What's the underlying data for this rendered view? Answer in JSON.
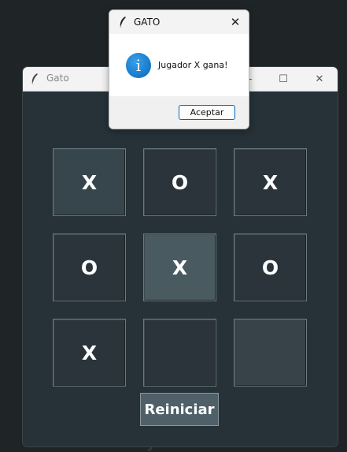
{
  "main_window": {
    "title": "Gato",
    "controls": {
      "minimize": "—",
      "maximize": "☐",
      "close": "✕"
    }
  },
  "board": {
    "cells": [
      "X",
      "O",
      "X",
      "O",
      "X",
      "O",
      "X",
      "",
      ""
    ]
  },
  "restart_label": "Reiniciar",
  "dialog": {
    "title": "GATO",
    "message": "Jugador X gana!",
    "accept_label": "Aceptar",
    "close_glyph": "✕",
    "info_glyph": "i"
  },
  "background_glyph": "y",
  "icons": {
    "window_icon": "feather-icon",
    "dialog_icon": "info-icon"
  },
  "colors": {
    "window_bg": "#263238",
    "cell_bg": "#2a343a",
    "cell_highlight": "#4a5a61",
    "accent": "#0067c0",
    "info": "#1577c9"
  }
}
